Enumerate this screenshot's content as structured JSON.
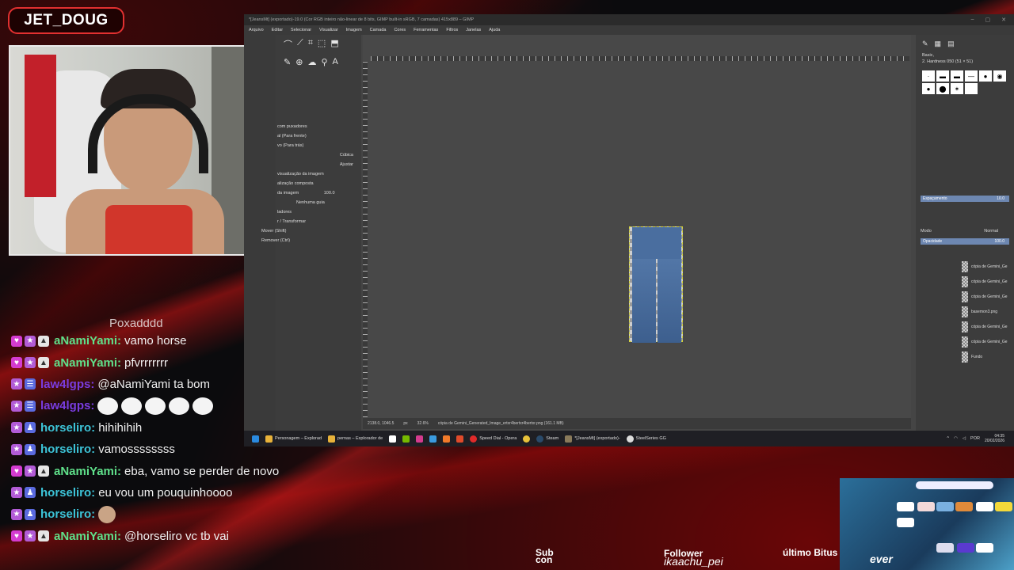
{
  "streamer": {
    "name": "JET_DOUG"
  },
  "gimp": {
    "title": "*[JeansMt] (exportado)-19.0 (Cor RGB inteiro não-linear de 8 bits, GIMP built-in sRGB, 7 camadas) 415x889 – GIMP",
    "menu": [
      "Arquivo",
      "Editar",
      "Selecionar",
      "Visualizar",
      "Imagem",
      "Camada",
      "Cores",
      "Ferramentas",
      "Filtros",
      "Janelas",
      "Ajuda"
    ],
    "tool_options": {
      "handles_label": "com puxadores",
      "direction_1": "al (Para frente)",
      "direction_2": "vo (Para trás)",
      "interpolation": "Cúbica",
      "clipping": "Ajustar",
      "preview_label": "visualização da imagem",
      "composite_label": "alização composta",
      "opacity_label": "da imagem",
      "opacity_value": "100.0",
      "guides": "Nenhuma guia",
      "ladores": "ladores",
      "transform_label": "r / Transformar",
      "move_label": "Mover (Shift)",
      "remove_label": "Remover (Ctrl)"
    },
    "status": {
      "coords": "2138.0, 1046.5",
      "unit": "px",
      "zoom": "32.6%",
      "file": "cópia de Gemini_Generated_Image_ertxr4bertxr4bertxr.png (161.1 MB)"
    },
    "dock": {
      "brush_name": "2. Hardness 050 (51 × 51)",
      "preset": "Basic,",
      "spacing_label": "Espaçamento",
      "spacing_value": "10.0",
      "mode_label": "Modo",
      "mode_value": "Normal",
      "opacity_label": "Opacidade",
      "opacity_value": "100.0",
      "layers": [
        "cópia de Gemini_Ge",
        "cópia de Gemini_Ge",
        "cópia de Gemini_Ge",
        "basemon3.png",
        "cópia de Gemini_Ge",
        "cópia de Gemini_Ge",
        "Fundo"
      ]
    }
  },
  "taskbar": {
    "items": [
      "Personagem – Explorad",
      "pernas – Explorador de",
      "Speed Dial - Opera",
      "Steam",
      "*[JeansMt] (exportado)-",
      "SteelSeries GG"
    ],
    "lang": "POR",
    "time": "04:35",
    "date": "20/02/2026"
  },
  "chat": [
    {
      "user": "",
      "msg": "Poxadddd",
      "color": "nami",
      "partial": true
    },
    {
      "user": "aNamiYami:",
      "msg": "vamo horse",
      "color": "nami"
    },
    {
      "user": "aNamiYami:",
      "msg": "pfvrrrrrrr",
      "color": "nami"
    },
    {
      "user": "law4lgps:",
      "msg": "@aNamiYami ta bom",
      "color": "law"
    },
    {
      "user": "law4lgps:",
      "msg": "",
      "color": "law",
      "emotes": 5
    },
    {
      "user": "horseliro:",
      "msg": "hihihihih",
      "color": "horse"
    },
    {
      "user": "horseliro:",
      "msg": "vamossssssss",
      "color": "horse"
    },
    {
      "user": "aNamiYami:",
      "msg": "eba, vamo se perder de novo",
      "color": "nami"
    },
    {
      "user": "horseliro:",
      "msg": "eu vou um pouquinhoooo",
      "color": "horse"
    },
    {
      "user": "horseliro:",
      "msg": "",
      "color": "horse",
      "face": true
    },
    {
      "user": "aNamiYami:",
      "msg": "@horseliro vc tb vai",
      "color": "nami"
    }
  ],
  "overlay": {
    "sub_line1": "Sub",
    "sub_line2": "con",
    "follower_label": "Follower",
    "follower_name": "ikaachu_pei",
    "ultimo_label": "último Bitus",
    "ever_label": "ever"
  }
}
